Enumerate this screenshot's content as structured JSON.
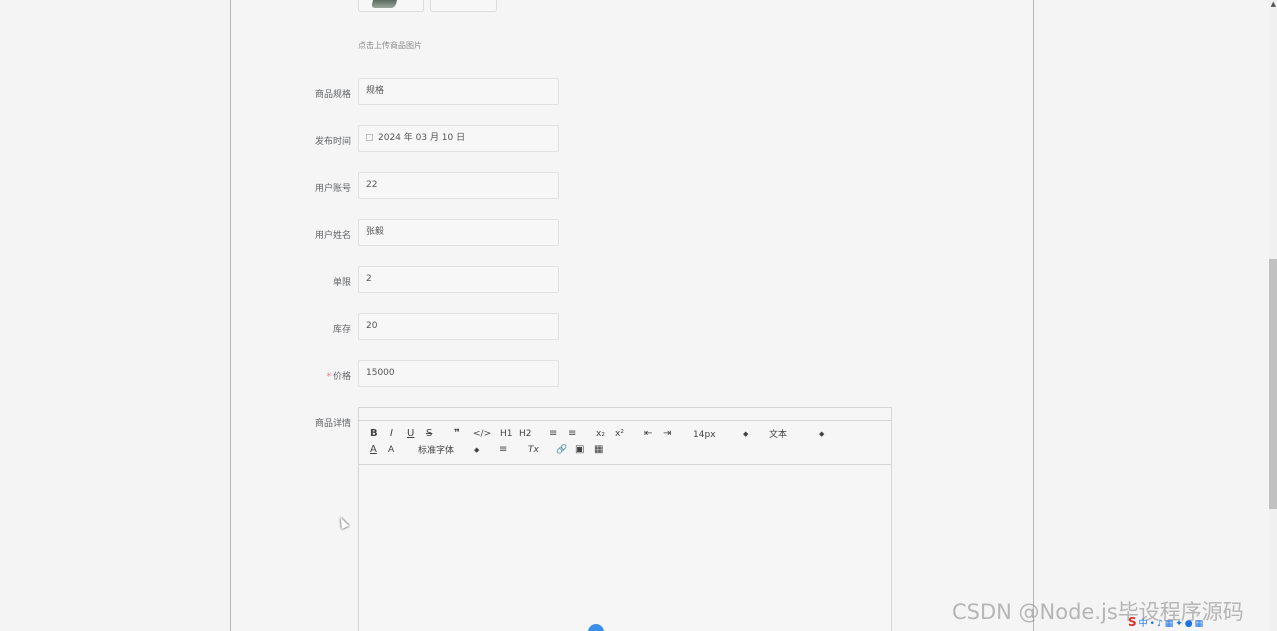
{
  "upload": {
    "tip": "点击上传商品图片"
  },
  "form": {
    "spec": {
      "label": "商品规格",
      "value": "规格"
    },
    "publish_time": {
      "label": "发布时间",
      "value": "2024 年 03 月 10 日"
    },
    "account": {
      "label": "用户账号",
      "value": "22"
    },
    "username": {
      "label": "用户姓名",
      "value": "张毅"
    },
    "limit": {
      "label": "单限",
      "value": "2"
    },
    "stock": {
      "label": "库存",
      "value": "20"
    },
    "price": {
      "label": "价格",
      "value": "15000",
      "required_mark": "*"
    },
    "detail": {
      "label": "商品详情"
    }
  },
  "editor": {
    "toolbar": {
      "bold": "B",
      "italic": "I",
      "underline": "U",
      "strike": "S",
      "quote": "❞",
      "code": "</>",
      "h1": "H1",
      "h2": "H2",
      "ordered_list": "≡",
      "bullet_list": "≡",
      "subscript": "x₂",
      "superscript": "x²",
      "outdent": "⇤",
      "indent": "⇥",
      "font_size": "14px",
      "text_type": "文本",
      "font_color": "A",
      "background": "A",
      "font_family": "标准字体",
      "align": "≡",
      "clear_format": "Tx",
      "link": "🔗",
      "image": "▣",
      "video": "▦"
    }
  },
  "watermark": "CSDN @Node.js毕设程序源码"
}
